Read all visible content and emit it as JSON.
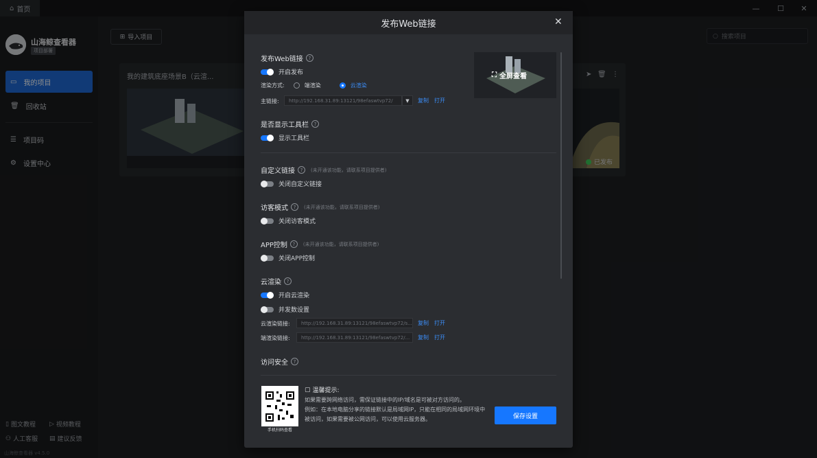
{
  "titlebar": {
    "home_tab": "首页"
  },
  "sidebar": {
    "app_name": "山海鲸查看器",
    "app_badge": "项目部署",
    "nav": [
      {
        "label": "我的项目",
        "icon": "monitor-icon"
      },
      {
        "label": "回收站",
        "icon": "trash-icon"
      },
      {
        "label": "项目码",
        "icon": "document-icon"
      },
      {
        "label": "设置中心",
        "icon": "gear-icon"
      }
    ],
    "footer": {
      "tutorial": "图文教程",
      "video": "视频教程",
      "service": "人工客服",
      "feedback": "建议反馈",
      "version": "山海鲸查看器 v4.5.0"
    }
  },
  "main": {
    "import_label": "导入项目",
    "search_placeholder": "搜索项目",
    "cards": [
      {
        "title": "我的建筑底座场景B（云渲..."
      },
      {
        "status": "已发布"
      }
    ]
  },
  "modal": {
    "title": "发布Web链接",
    "publish": {
      "title": "发布Web链接",
      "toggle_label": "开启发布",
      "render_label": "渲染方式:",
      "render_options": [
        "端渲染",
        "云渲染"
      ],
      "main_link_label": "主链接:",
      "main_link_value": "http://192.168.31.89:13121/98efaswtvp72/",
      "copy": "复制",
      "open": "打开"
    },
    "preview": {
      "fullscreen_label": "全屏查看"
    },
    "toolbar": {
      "title": "是否显示工具栏",
      "toggle_label": "显示工具栏"
    },
    "custom_link": {
      "title": "自定义链接",
      "note": "(未开通该功能，请联系项目提供者)",
      "toggle_label": "关闭自定义链接"
    },
    "visitor": {
      "title": "访客模式",
      "note": "(未开通该功能，请联系项目提供者)",
      "toggle_label": "关闭访客模式"
    },
    "app_control": {
      "title": "APP控制",
      "note": "(未开通该功能，请联系项目提供者)",
      "toggle_label": "关闭APP控制"
    },
    "cloud": {
      "title": "云渲染",
      "toggle_label": "开启云渲染",
      "concurrency_label": "并发数设置",
      "cloud_link_label": "云渲染链接:",
      "cloud_link_value": "http://192.168.31.89:13121/98efaswtvp72/s...",
      "end_link_label": "端渲染链接:",
      "end_link_value": "http://192.168.31.89:13121/98efaswtvp72/...",
      "copy": "复制",
      "open": "打开"
    },
    "security": {
      "title": "访问安全"
    },
    "tips": {
      "title": "温馨提示:",
      "line1": "如果需要跨网络访问，需保证链接中的IP/域名是可被对方访问的。",
      "line2": "例如：在本地电脑分享的链接默认是局域网IP，只能在相同的局域网环境中被访问，如果需要被公网访问，可以使用云服务器。",
      "qr_caption": "手机扫码查看"
    },
    "save_label": "保存设置"
  }
}
